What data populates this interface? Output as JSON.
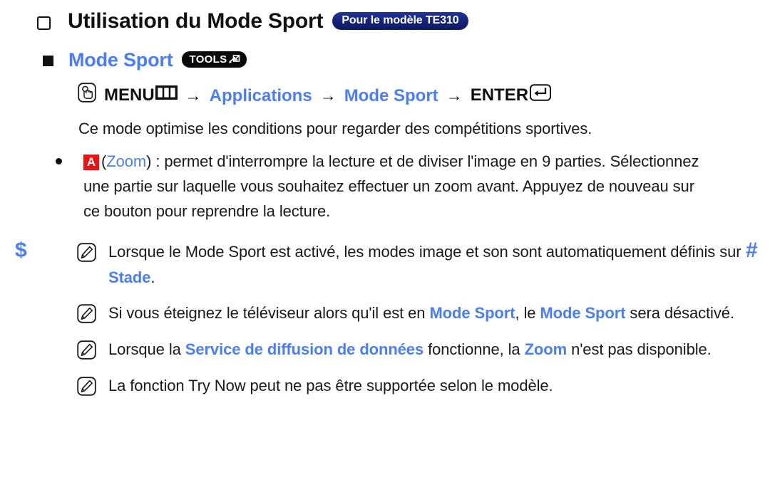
{
  "nav_markers": {
    "prev": "$",
    "next": "#",
    "color": "#4a7dfc"
  },
  "colors": {
    "accent_blue": "#4a7dfc",
    "badge_navy": "#142276",
    "key_red": "#ee1111",
    "badge_black": "#0a0a0a",
    "text": "#1a1a1a"
  },
  "title": {
    "bullet_icon": "hollow-square-icon",
    "text": "Utilisation du Mode Sport",
    "model_badge": "Pour le modèle TE310"
  },
  "section": {
    "bullet_icon": "filled-square-icon",
    "heading": "Mode Sport",
    "tools_badge": "TOOLS",
    "tools_badge_icon": "tools-arrow-icon"
  },
  "menu_path": {
    "hand_icon": "hand-press-icon",
    "items": [
      {
        "label": "MENU",
        "color": "black",
        "icon": "menu-grid-icon"
      },
      {
        "label": "Applications",
        "color": "blue",
        "icon": ""
      },
      {
        "label": "Mode Sport",
        "color": "blue",
        "icon": ""
      },
      {
        "label": "ENTER",
        "color": "black",
        "icon": "enter-return-icon"
      }
    ],
    "separator": "→"
  },
  "intro_paragraph": "Ce mode optimise les conditions pour regarder des compétitions sportives.",
  "bullet": {
    "marker_icon": "dot-bullet-icon",
    "key_badge": "A",
    "key_label": "Zoom",
    "line1_rest": ") : permet d'interrompre la lecture et de diviser l'image en 9 parties.",
    "line2": "Sélectionnez une partie sur laquelle vous souhaitez effectuer un zoom avant.",
    "line3": "Appuyez de nouveau sur ce bouton pour reprendre la lecture."
  },
  "notes": [
    {
      "icon": "note-pencil-icon",
      "parts": [
        {
          "text": "Lorsque le Mode Sport est activé, les modes image et son sont automatiquement définis sur ",
          "style": "plain"
        },
        {
          "text": "Stade",
          "style": "blue-bold"
        },
        {
          "text": ".",
          "style": "plain"
        }
      ]
    },
    {
      "icon": "note-pencil-icon",
      "parts": [
        {
          "text": "Si vous éteignez le téléviseur alors qu'il est en ",
          "style": "plain"
        },
        {
          "text": "Mode Sport",
          "style": "blue-bold"
        },
        {
          "text": ", le ",
          "style": "plain"
        },
        {
          "text": "Mode Sport",
          "style": "blue-bold"
        },
        {
          "text": " sera désactivé.",
          "style": "plain"
        }
      ]
    },
    {
      "icon": "note-pencil-icon",
      "parts": [
        {
          "text": "Lorsque la ",
          "style": "plain"
        },
        {
          "text": "Service de diffusion de données",
          "style": "blue-bold"
        },
        {
          "text": " fonctionne, la ",
          "style": "plain"
        },
        {
          "text": "Zoom",
          "style": "blue-bold"
        },
        {
          "text": " n'est pas disponible.",
          "style": "plain"
        }
      ]
    },
    {
      "icon": "note-pencil-icon",
      "parts": [
        {
          "text": "La fonction Try Now peut ne pas être supportée selon le modèle.",
          "style": "plain"
        }
      ]
    }
  ]
}
